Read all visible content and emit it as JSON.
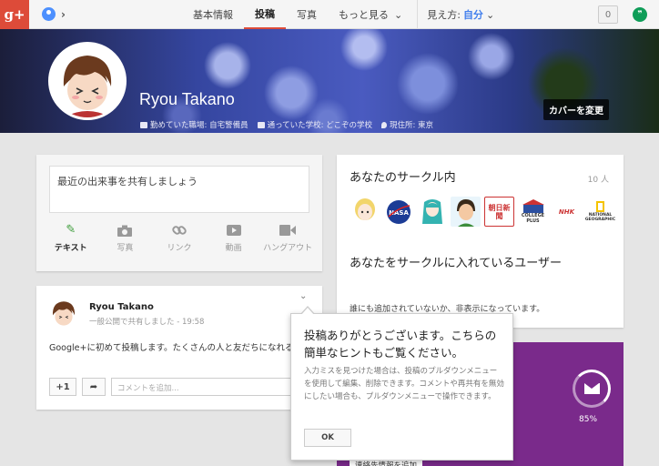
{
  "app": {
    "logo_text": "g+"
  },
  "nav": {
    "tabs": [
      {
        "label": "基本情報"
      },
      {
        "label": "投稿"
      },
      {
        "label": "写真"
      },
      {
        "label": "もっと見る"
      }
    ],
    "view_as_label": "見え方:",
    "view_as_value": "自分",
    "notification_count": "0"
  },
  "profile": {
    "name": "Ryou Takano",
    "work": "勤めていた職場: 自宅警備員",
    "school": "通っていた学校: どこぞの学校",
    "location": "現住所: 東京",
    "change_cover": "カバーを変更"
  },
  "share": {
    "placeholder": "最近の出来事を共有しましょう",
    "actions": [
      {
        "label": "テキスト",
        "icon": "pencil-icon"
      },
      {
        "label": "写真",
        "icon": "camera-icon"
      },
      {
        "label": "リンク",
        "icon": "link-icon"
      },
      {
        "label": "動画",
        "icon": "video-icon"
      },
      {
        "label": "ハングアウト",
        "icon": "hangout-camera-icon"
      }
    ]
  },
  "post": {
    "author": "Ryou Takano",
    "meta": "一般公開で共有しました - 19:58",
    "text": "Google+に初めて投稿します。たくさんの人と友だちになれるといいな",
    "plus_one": "+1",
    "comment_placeholder": "コメントを追加..."
  },
  "circles": {
    "title": "あなたのサークル内",
    "count": "10 人",
    "members": [
      "",
      "NASA",
      "",
      "",
      "朝日新聞",
      "COLLEGE PLUS",
      "NHK",
      "NATIONAL GEOGRAPHIC"
    ],
    "in_circles_title": "あなたをサークルに入れているユーザー",
    "in_circles_note": "誰にも追加されていないか、非表示になっています。"
  },
  "profile_progress": {
    "percent": "85%",
    "button": "連絡先情報を追加"
  },
  "tooltip": {
    "title": "投稿ありがとうございます。こちらの簡単なヒントもご覧ください。",
    "body": "入力ミスを見つけた場合は、投稿のプルダウンメニューを使用して編集、削除できます。コメントや再共有を無効にしたい場合も、プルダウンメニューで操作できます。",
    "ok": "OK"
  },
  "colors": {
    "brand_red": "#dd4b39",
    "accent_blue": "#427fed",
    "purple": "#7a2a8b",
    "green": "#3d9c3a"
  }
}
